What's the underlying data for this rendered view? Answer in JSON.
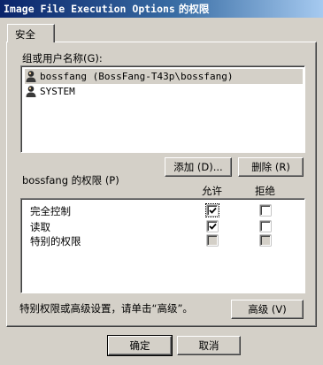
{
  "window": {
    "title_prefix": "Image File Execution Options",
    "title_suffix": " 的权限"
  },
  "tabs": [
    {
      "label": "安全"
    }
  ],
  "users_section": {
    "label": "组或用户名称",
    "accel": "(G):",
    "users": [
      {
        "name": "bossfang (BossFang-T43p\\bossfang)",
        "selected": true,
        "icon": "user-icon"
      },
      {
        "name": "SYSTEM",
        "selected": false,
        "icon": "user-icon"
      }
    ]
  },
  "buttons": {
    "add": "添加 (D)...",
    "remove": "删除 (R)",
    "advanced": "高级 (V)",
    "ok": "确定",
    "cancel": "取消"
  },
  "permissions": {
    "label": "bossfang 的权限 (P)",
    "allow_header": "允许",
    "deny_header": "拒绝",
    "rows": [
      {
        "name": "完全控制",
        "allow": true,
        "deny": false,
        "enabled": true
      },
      {
        "name": "读取",
        "allow": true,
        "deny": false,
        "enabled": true
      },
      {
        "name": "特别的权限",
        "allow": false,
        "deny": false,
        "enabled": false
      }
    ]
  },
  "advanced_hint": "特别权限或高级设置，请单击“高级”。"
}
